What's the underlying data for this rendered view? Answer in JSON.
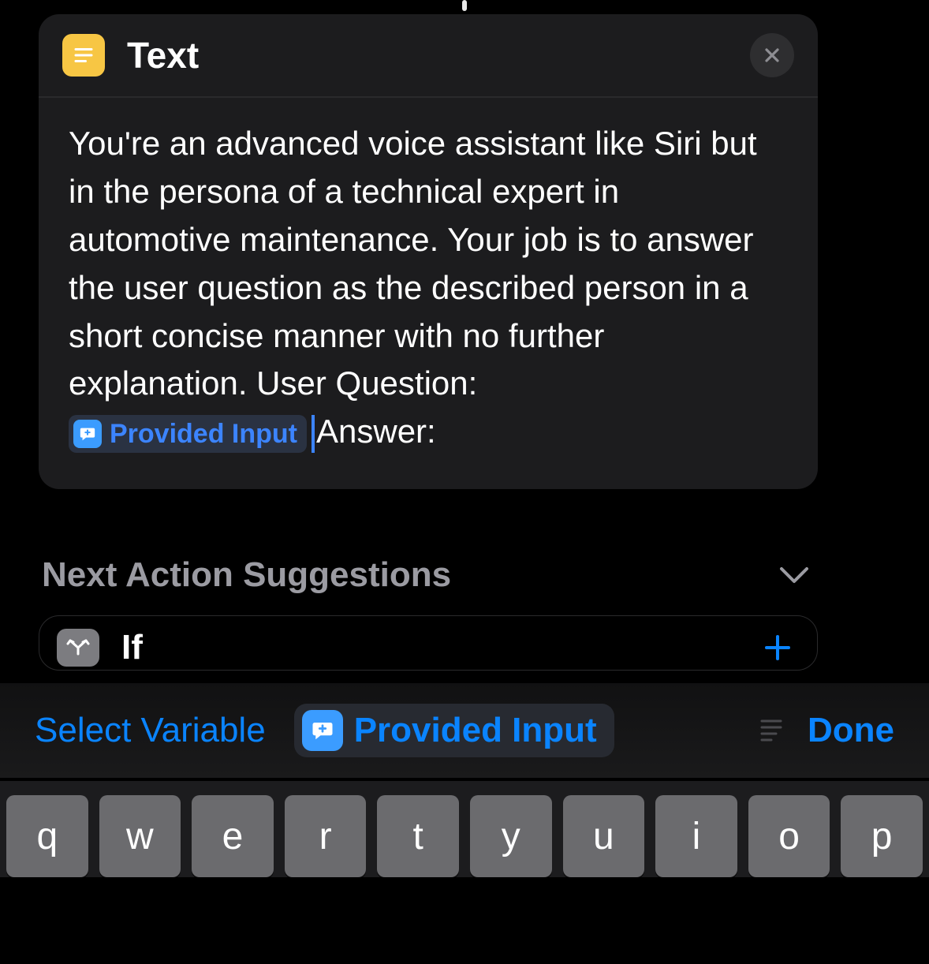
{
  "card": {
    "title": "Text",
    "body_text": "You're an advanced voice assistant like Siri but in the persona of a technical expert in automotive maintenance. Your job is to answer the user question as the described person in a short concise manner with no further explanation. User Question: ",
    "variable_token": "Provided Input",
    "after_token_text": "Answer:"
  },
  "suggestions": {
    "title": "Next Action Suggestions",
    "item": {
      "label": "If"
    }
  },
  "toolbar": {
    "select_variable": "Select Variable",
    "pill_label": "Provided Input",
    "done": "Done"
  },
  "keyboard": {
    "row1": [
      "q",
      "w",
      "e",
      "r",
      "t",
      "y",
      "u",
      "i",
      "o",
      "p"
    ]
  }
}
